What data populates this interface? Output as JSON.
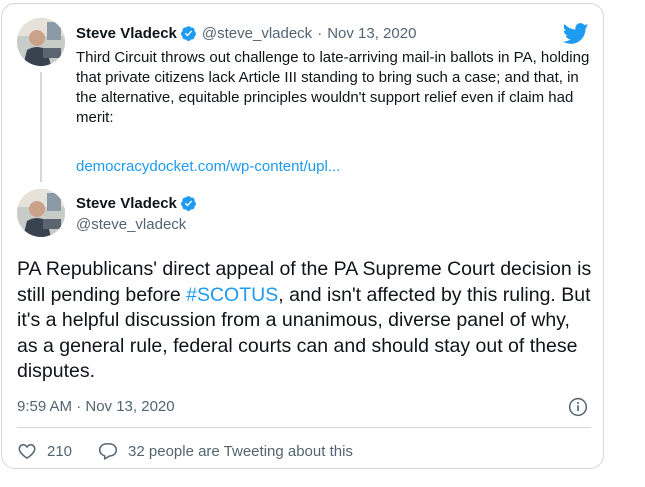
{
  "parent_tweet": {
    "name": "Steve Vladeck",
    "handle": "@steve_vladeck",
    "separator": "·",
    "date": "Nov 13, 2020",
    "text": "Third Circuit throws out challenge to late-arriving mail-in ballots in PA, holding that private citizens lack Article III standing to bring such a case; and that, in the alternative, equitable principles wouldn't support relief even if claim had merit:",
    "link": "democracydocket.com/wp-content/upl..."
  },
  "main_tweet": {
    "name": "Steve Vladeck",
    "handle": "@steve_vladeck",
    "text_before": "PA Republicans' direct appeal of the PA Supreme Court decision is still pending before ",
    "hashtag": "#SCOTUS",
    "text_after": ", and isn't affected by this ruling. But it's a helpful discussion from a unanimous, diverse panel of why, as a general rule, federal courts can and should stay out of these disputes.",
    "timestamp": "9:59 AM · Nov 13, 2020",
    "like_count": "210",
    "reply_text": "32 people are Tweeting about this"
  },
  "colors": {
    "link": "#1d9bf0",
    "secondary_text": "#536471",
    "border": "#cfd9de"
  },
  "icons": [
    "verified-badge-icon",
    "twitter-bird-icon",
    "info-icon",
    "heart-icon",
    "reply-bubble-icon"
  ]
}
